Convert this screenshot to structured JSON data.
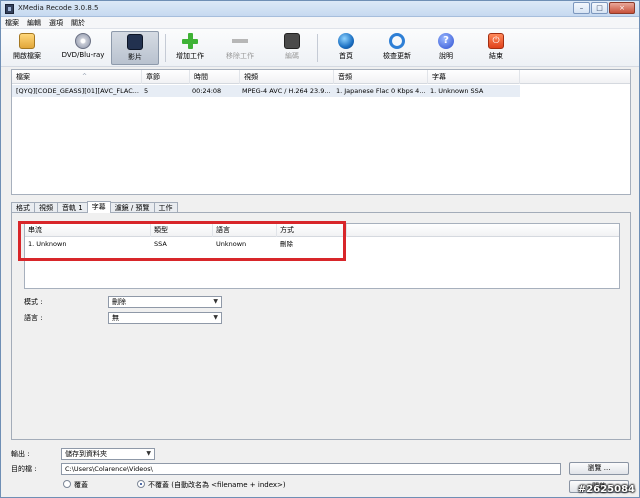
{
  "window": {
    "title": "XMedia Recode 3.0.8.5",
    "controls": {
      "minimize": "–",
      "maximize": "□",
      "close": "×"
    }
  },
  "menu": [
    "檔案",
    "編輯",
    "選項",
    "關於"
  ],
  "toolbar": {
    "open": "開啟檔案",
    "dvd": "DVD/Blu-ray",
    "video": "影片",
    "add_job": "增加工作",
    "remove_job": "移除工作",
    "encode": "編碼",
    "home": "首頁",
    "update": "檢查更新",
    "help": "說明",
    "exit": "結束",
    "help_glyph": "?",
    "exit_glyph": "⏻"
  },
  "job_list": {
    "columns": [
      "檔案",
      "章節",
      "時間",
      "視頻",
      "音頻",
      "字幕"
    ],
    "sort_indicator": "^",
    "rows": [
      {
        "file": "[QYQ][CODE_GEASS][01][AVC_FLAC...",
        "chapters": "5",
        "time": "00:24:08",
        "video": "MPEG-4 AVC / H.264 23.9...",
        "audio": "1. Japanese Flac 0 Kbps 4...",
        "subtitle": "1. Unknown SSA"
      }
    ]
  },
  "tabs": [
    "格式",
    "視頻",
    "音軌 1",
    "字幕",
    "濾鏡 / 預覽",
    "工作"
  ],
  "active_tab": "字幕",
  "subtitle_list": {
    "columns": [
      "串流",
      "類型",
      "語言",
      "方式"
    ],
    "rows": [
      {
        "stream": "1. Unknown",
        "type": "SSA",
        "language": "Unknown",
        "mode": "刪除"
      }
    ]
  },
  "form": {
    "mode_label": "模式 :",
    "mode_value": "刪除",
    "language_label": "語言 :",
    "language_value": "無"
  },
  "output": {
    "output_label": "輸出 :",
    "output_value": "儲存到資料夾",
    "dest_label": "目的檔 :",
    "dest_path": "C:\\Users\\Colarence\\Videos\\",
    "browse_button": "瀏覽 ...",
    "open_button": "開啟",
    "overwrite_label": "覆蓋",
    "no_overwrite_label": "不覆蓋 (自動改名為 <filename + index>)",
    "selected": "no_overwrite"
  },
  "watermark": "#2625084",
  "colors": {
    "highlight": "#d8262a",
    "selected_row": "#e7edf5",
    "titlebar": "#c6d9f0"
  }
}
